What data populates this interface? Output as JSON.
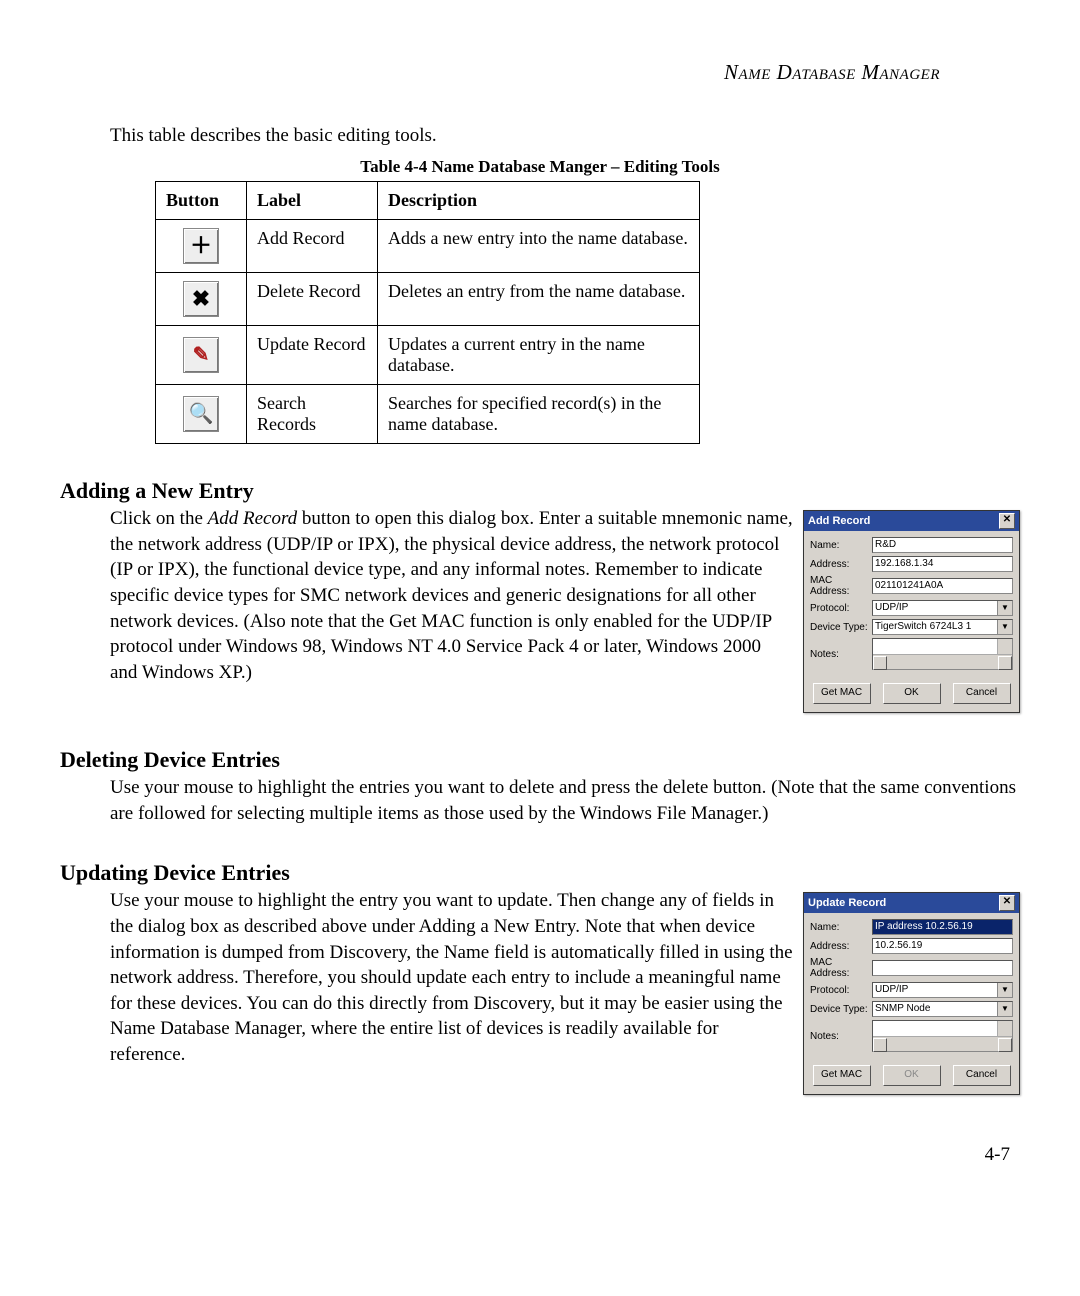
{
  "running_head": "Name Database Manager",
  "intro": "This table describes the basic editing tools.",
  "table_caption": "Table 4-4  Name Database Manger – Editing Tools",
  "headers": {
    "button": "Button",
    "label": "Label",
    "description": "Description"
  },
  "tools": [
    {
      "icon": "＋",
      "icon_name": "add-record-icon",
      "label": "Add Record",
      "desc": "Adds a new entry into the name database."
    },
    {
      "icon": "✖",
      "icon_name": "delete-record-icon",
      "label": "Delete Record",
      "desc": "Deletes an entry from the name database."
    },
    {
      "icon": "✎",
      "icon_name": "update-record-icon",
      "icon_class": "pencil",
      "label": "Update Record",
      "desc": "Updates a current entry in the name database."
    },
    {
      "icon": "🔍",
      "icon_name": "search-records-icon",
      "icon_class": "search",
      "label": "Search Records",
      "desc": "Searches for specified record(s) in the name database."
    }
  ],
  "sections": {
    "adding": {
      "heading": "Adding a New Entry",
      "para_before_ital": "Click on the ",
      "ital": "Add Record",
      "para_after_ital": " button to open this dialog box. Enter a suitable mnemonic name, the network address (UDP/IP or IPX), the physical device address, the network protocol (IP or IPX), the functional device type, and any informal notes. Remember to indicate specific device types for SMC network devices and generic designations for all other network devices. (Also note that the Get MAC function is only enabled for the UDP/IP protocol under Windows 98, Windows NT 4.0 Service Pack 4 or later, Windows 2000 and Windows XP.)"
    },
    "deleting": {
      "heading": "Deleting Device Entries",
      "para": "Use your mouse to highlight the entries you want to delete and press the delete button. (Note that the same conventions are followed for selecting multiple items as those used by the Windows File Manager.)"
    },
    "updating": {
      "heading": "Updating Device Entries",
      "para": "Use your mouse to highlight the entry you want to update. Then change any of fields in the dialog box as described above under Adding a New Entry. Note that when device information is dumped from Discovery, the Name field is automatically filled in using the network address. Therefore, you should update each entry to include a meaningful name for these devices. You can do this directly from Discovery, but it may be easier using the Name Database Manager, where the entire list of devices is readily available for reference."
    }
  },
  "dialog_labels": {
    "name": "Name:",
    "address": "Address:",
    "mac": "MAC Address:",
    "protocol": "Protocol:",
    "device_type": "Device Type:",
    "notes": "Notes:",
    "get_mac": "Get MAC",
    "ok": "OK",
    "cancel": "Cancel",
    "close": "✕"
  },
  "add_dialog": {
    "title": "Add Record",
    "name": "R&D",
    "address": "192.168.1.34",
    "mac": "021101241A0A",
    "protocol": "UDP/IP",
    "device_type": "TigerSwitch 6724L3 1"
  },
  "update_dialog": {
    "title": "Update Record",
    "name": "IP address 10.2.56.19",
    "address": "10.2.56.19",
    "mac": "",
    "protocol": "UDP/IP",
    "device_type": "SNMP Node"
  },
  "page_number": "4-7"
}
